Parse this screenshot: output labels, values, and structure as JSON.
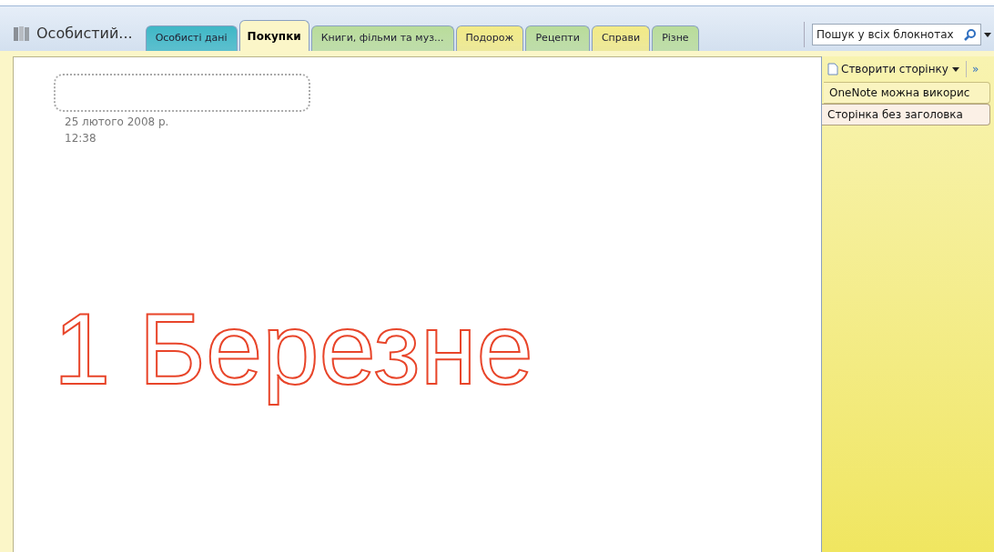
{
  "notebook": {
    "title": "Особистий..."
  },
  "tabs": [
    {
      "label": "Особисті дані",
      "selected": false,
      "color": "#3fb7c6"
    },
    {
      "label": "Покупки",
      "selected": true,
      "color": "#fbf6c8"
    },
    {
      "label": "Книги, фільми та муз...",
      "selected": false,
      "color": "#b9dc9a"
    },
    {
      "label": "Подорож",
      "selected": false,
      "color": "#f2ea86"
    },
    {
      "label": "Рецепти",
      "selected": false,
      "color": "#b9dc9a"
    },
    {
      "label": "Справи",
      "selected": false,
      "color": "#f2ea86"
    },
    {
      "label": "Різне",
      "selected": false,
      "color": "#b9dc9a"
    }
  ],
  "search": {
    "placeholder": "Пошук у всіх блокнотах"
  },
  "page": {
    "date": "25 лютого 2008 р.",
    "time": "12:38",
    "ink": "1 Березне"
  },
  "page_pane": {
    "new_page": "Створити сторінку",
    "more": "»",
    "pages": [
      {
        "title": "OneNote можна викорис",
        "selected": false
      },
      {
        "title": "Сторінка без заголовка",
        "selected": true
      }
    ]
  }
}
